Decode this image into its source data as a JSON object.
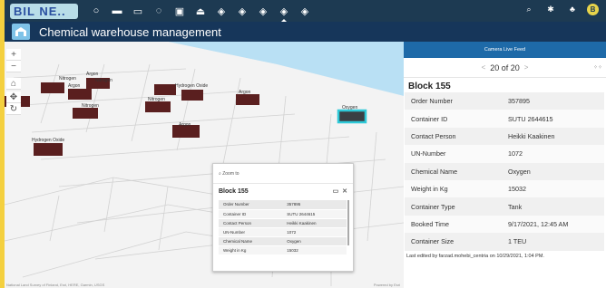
{
  "logo": {
    "text": "BIL NE.."
  },
  "toolbar": {
    "icons": [
      "circle-icon",
      "folder-icon",
      "image-icon",
      "search-icon",
      "calendar-icon",
      "print-icon",
      "layers-icon",
      "layers-icon",
      "layers-icon",
      "layers-icon",
      "layers-icon"
    ],
    "right": [
      "search-icon",
      "star-icon",
      "user-icon"
    ],
    "avatar": "B"
  },
  "header": {
    "title": "Chemical warehouse management"
  },
  "map": {
    "labels": [
      "Nitrogen",
      "Argon",
      "Nitrogen",
      "Argon",
      "Nitrogen",
      "Hydrogen Oxide",
      "Argon",
      "Nitrogen",
      "Argon",
      "Hydrogen Oxide",
      "Oxygen"
    ],
    "attribution": "National Land Survey of Finland, Esri, HERE, Garmin, USGS",
    "powered": "Powered by Esri"
  },
  "popup": {
    "zoom": "Zoom to",
    "title": "Block 155",
    "rows": [
      [
        "Order Number",
        "357895"
      ],
      [
        "Container ID",
        "SUTU 2644615"
      ],
      [
        "Contact Person",
        "Heikki Kaakinen"
      ],
      [
        "UN-Number",
        "1072"
      ],
      [
        "Chemical Name",
        "Oxygen"
      ],
      [
        "Weight in Kg",
        "15032"
      ]
    ]
  },
  "panel": {
    "feed": "Camera Live Feed",
    "pager": "20 of 20",
    "title": "Block 155",
    "rows": [
      [
        "Order Number",
        "357895"
      ],
      [
        "Container ID",
        "SUTU 2644615"
      ],
      [
        "Contact Person",
        "Heikki Kaakinen"
      ],
      [
        "UN-Number",
        "1072"
      ],
      [
        "Chemical Name",
        "Oxygen"
      ],
      [
        "Weight in Kg",
        "15032"
      ],
      [
        "Container Type",
        "Tank"
      ],
      [
        "Booked Time",
        "9/17/2021, 12:45 AM"
      ],
      [
        "Container Size",
        "1 TEU"
      ]
    ],
    "last_edited": "Last edited by farzad.mohebi_centria on 10/29/2021, 1:04 PM."
  }
}
